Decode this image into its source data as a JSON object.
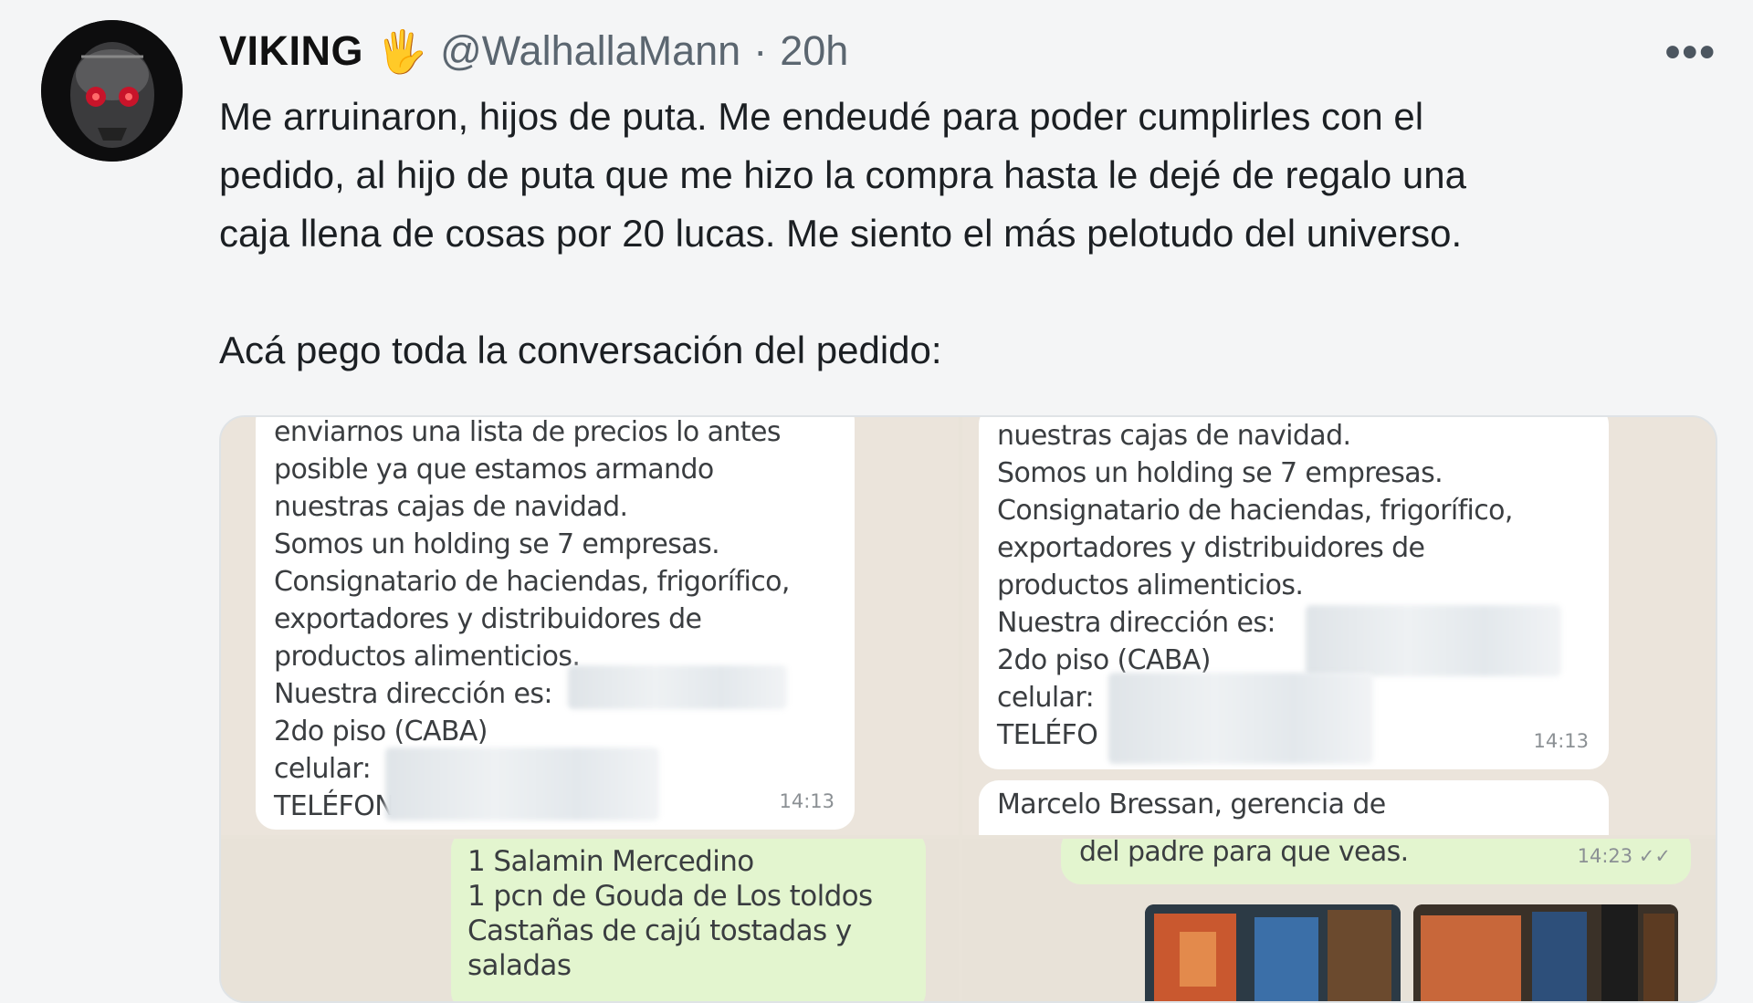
{
  "tweet": {
    "author_name": "VIKING",
    "author_emoji": "🖐",
    "handle": "@WalhallaMann",
    "separator": "·",
    "age": "20h",
    "more_label": "•••",
    "text_lines": [
      "Me arruinaron, hijos de puta. Me endeudé para poder cumplirles con el",
      "pedido, al hijo de puta que me hizo la compra hasta le dejé de regalo una",
      "caja llena de cosas por 20 lucas. Me siento el más pelotudo del universo."
    ],
    "text_line2": "Acá pego toda la conversación del pedido:"
  },
  "media": {
    "top_left": {
      "lines": [
        "enviarnos una lista de precios lo antes",
        "posible ya que estamos armando",
        "nuestras cajas de navidad.",
        "Somos un holding se 7 empresas.",
        "Consignatario de haciendas, frigorífico,",
        "exportadores y distribuidores de",
        "productos alimenticios.",
        "Nuestra dirección es:",
        "2do piso (CABA)",
        "celular:",
        "TELÉFON"
      ],
      "time": "14:13"
    },
    "top_right": {
      "lines": [
        "nuestras cajas de navidad.",
        "Somos un holding se 7 empresas.",
        "Consignatario de haciendas, frigorífico,",
        "exportadores y distribuidores de",
        "productos alimenticios.",
        "Nuestra dirección es:",
        "2do piso (CABA)",
        "celular:",
        "TELÉFO"
      ],
      "time": "14:13",
      "next_line": "Marcelo Bressan, gerencia de"
    },
    "bottom_left": {
      "lines": [
        "1 Salamin Mercedino",
        "1 pcn de Gouda de Los toldos",
        "Castañas de cajú tostadas y",
        "saladas"
      ]
    },
    "bottom_right": {
      "line": "del padre para que veas.",
      "time": "14:23 ✓✓"
    }
  },
  "colors": {
    "text": "#1b1f23",
    "muted": "#5b6670",
    "chat_bg": "#ebe4db",
    "bubble_in": "#ffffff",
    "bubble_out": "#e3f5cf"
  }
}
